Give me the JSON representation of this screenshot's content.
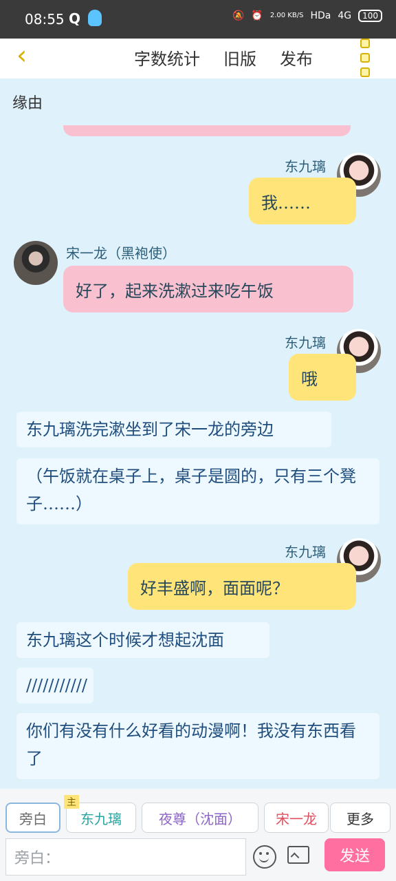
{
  "status": {
    "time": "08:55",
    "q": "Q",
    "speed": "2.00\nKB/S",
    "hd": "HDa",
    "network": "4G",
    "battery": "100"
  },
  "header": {
    "nav": [
      "字数统计",
      "旧版",
      "发布"
    ]
  },
  "section_title": "缘由",
  "messages": [
    {
      "name": "东九璃",
      "text": "我……"
    },
    {
      "name": "宋一龙（黑袍使）",
      "text": "好了，起来洗漱过来吃午饭"
    },
    {
      "name": "东九璃",
      "text": "哦"
    },
    {
      "text": "东九璃洗完漱坐到了宋一龙的旁边"
    },
    {
      "text": "（午饭就在桌子上，桌子是圆的，只有三个凳子……）"
    },
    {
      "name": "东九璃",
      "text": "好丰盛啊，面面呢？"
    },
    {
      "text": "东九璃这个时候才想起沈面"
    },
    {
      "text": "///////////"
    },
    {
      "text": "你们有没有什么好看的动漫啊！我没有东西看了"
    }
  ],
  "bottom": {
    "tabs": [
      "旁白",
      "东九璃",
      "夜尊（沈面）",
      "宋一龙",
      "更多"
    ],
    "main_tag": "主",
    "input_placeholder": "旁白：",
    "send_label": "发送"
  }
}
